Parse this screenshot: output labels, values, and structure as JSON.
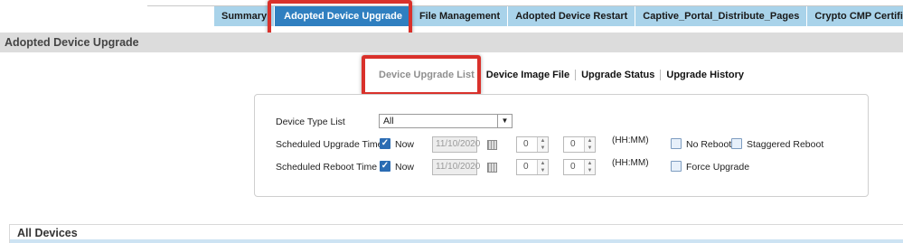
{
  "tabs": [
    {
      "label": "Summary",
      "active": false
    },
    {
      "label": "Adopted Device Upgrade",
      "active": true
    },
    {
      "label": "File Management",
      "active": false
    },
    {
      "label": "Adopted Device Restart",
      "active": false
    },
    {
      "label": "Captive_Portal_Distribute_Pages",
      "active": false
    },
    {
      "label": "Crypto CMP Certificate",
      "active": false
    }
  ],
  "page": {
    "title": "Adopted Device Upgrade"
  },
  "subnav": [
    {
      "label": "Device Upgrade List",
      "active": true
    },
    {
      "label": "Device Image File",
      "active": false
    },
    {
      "label": "Upgrade Status",
      "active": false
    },
    {
      "label": "Upgrade History",
      "active": false
    }
  ],
  "form": {
    "device_type_label": "Device Type List",
    "device_type_value": "All",
    "upgrade_time_label": "Scheduled Upgrade Time",
    "reboot_time_label": "Scheduled Reboot Time",
    "now_label": "Now",
    "upgrade_date": "11/10/2020",
    "reboot_date": "11/10/2020",
    "upgrade_hh": "0",
    "upgrade_mm": "0",
    "reboot_hh": "0",
    "reboot_mm": "0",
    "hhmm_label": "(HH:MM)",
    "no_reboot_label": "No Reboot",
    "staggered_reboot_label": "Staggered Reboot",
    "force_upgrade_label": "Force Upgrade"
  },
  "all_devices": {
    "title": "All Devices"
  },
  "colors": {
    "active_tab": "#2f7fc0",
    "tab": "#a9d3ea",
    "highlight": "#d9312b"
  }
}
